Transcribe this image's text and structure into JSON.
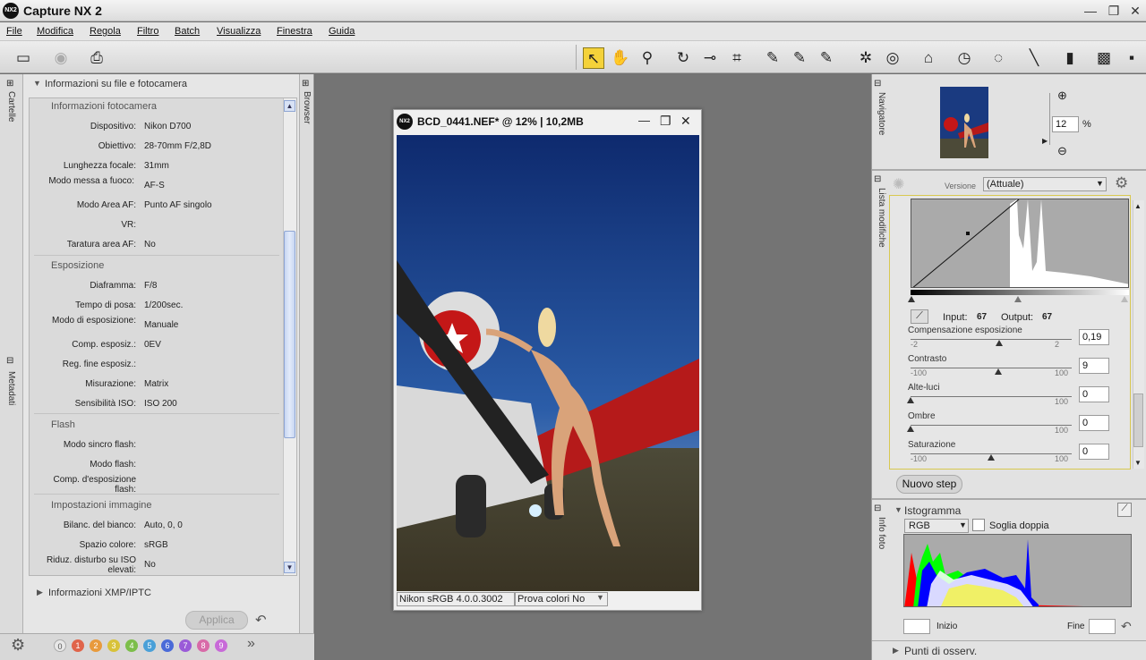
{
  "app": {
    "title": "Capture NX 2",
    "logo_text": "NX2"
  },
  "window_buttons": {
    "minimize": "—",
    "restore": "❐",
    "close": "✕"
  },
  "menu": [
    "File",
    "Modifica",
    "Regola",
    "Filtro",
    "Batch",
    "Visualizza",
    "Finestra",
    "Guida"
  ],
  "left_tabs": {
    "folders": "Cartelle",
    "metadata": "Metadati",
    "browser": "Browser"
  },
  "left_panel": {
    "header": "Informazioni su file e fotocamera",
    "sections": [
      {
        "title": "Informazioni fotocamera",
        "rows": [
          {
            "label": "Dispositivo:",
            "value": "Nikon D700"
          },
          {
            "label": "Obiettivo:",
            "value": "28-70mm F/2,8D"
          },
          {
            "label": "Lunghezza focale:",
            "value": "31mm"
          },
          {
            "label": "Modo messa a fuoco:",
            "value": "AF-S"
          },
          {
            "label": "Modo Area AF:",
            "value": "Punto AF singolo"
          },
          {
            "label": "VR:",
            "value": ""
          },
          {
            "label": "Taratura area AF:",
            "value": "No"
          }
        ]
      },
      {
        "title": "Esposizione",
        "rows": [
          {
            "label": "Diaframma:",
            "value": "F/8"
          },
          {
            "label": "Tempo di posa:",
            "value": "1/200sec."
          },
          {
            "label": "Modo di esposizione:",
            "value": "Manuale"
          },
          {
            "label": "Comp. esposiz.:",
            "value": "0EV"
          },
          {
            "label": "Reg. fine esposiz.:",
            "value": ""
          },
          {
            "label": "Misurazione:",
            "value": "Matrix"
          },
          {
            "label": "Sensibilità ISO:",
            "value": "ISO 200"
          }
        ]
      },
      {
        "title": "Flash",
        "rows": [
          {
            "label": "Modo sincro flash:",
            "value": ""
          },
          {
            "label": "Modo flash:",
            "value": ""
          },
          {
            "label": "Comp. d'esposizione flash:",
            "value": ""
          }
        ]
      },
      {
        "title": "Impostazioni immagine",
        "rows": [
          {
            "label": "Bilanc. del bianco:",
            "value": "Auto, 0, 0"
          },
          {
            "label": "Spazio colore:",
            "value": "sRGB"
          },
          {
            "label": "Riduz. disturbo su ISO elevati:",
            "value": "No"
          }
        ]
      }
    ],
    "xmp_header": "Informazioni XMP/IPTC",
    "apply_button": "Applica"
  },
  "labels_bar": [
    "0",
    "1",
    "2",
    "3",
    "4",
    "5",
    "6",
    "7",
    "8",
    "9"
  ],
  "label_colors": [
    "#e8e8e8",
    "#e0644a",
    "#e89a3c",
    "#d8c23a",
    "#7cbe4a",
    "#4aa0d8",
    "#4a6ad8",
    "#9a5ad8",
    "#d86aa8",
    "#c86ad8"
  ],
  "image_window": {
    "title": "BCD_0441.NEF* @ 12% | 10,2MB",
    "profile": "Nikon sRGB 4.0.0.3002",
    "proof": "Prova colori No"
  },
  "navigator": {
    "tab": "Navigatore",
    "zoom": "12",
    "zoom_unit": "%"
  },
  "edit_list": {
    "tab": "Lista modifiche",
    "version_label": "Versione",
    "version_value": "(Attuale)",
    "input_label": "Input:",
    "input_value": "67",
    "output_label": "Output:",
    "output_value": "67",
    "sliders": [
      {
        "name": "Compensazione esposizione",
        "min": "-2",
        "max": "2",
        "value": "0,19",
        "fraction": 0.55
      },
      {
        "name": "Contrasto",
        "min": "-100",
        "max": "100",
        "value": "9",
        "fraction": 0.545
      },
      {
        "name": "Alte-luci",
        "min": "",
        "max": "100",
        "value": "0",
        "fraction": 0
      },
      {
        "name": "Ombre",
        "min": "",
        "max": "100",
        "value": "0",
        "fraction": 0
      },
      {
        "name": "Saturazione",
        "min": "-100",
        "max": "100",
        "value": "0",
        "fraction": 0.5
      }
    ],
    "new_step": "Nuovo step"
  },
  "photo_info": {
    "tab": "Info foto",
    "histogram_title": "Istogramma",
    "channel": "RGB",
    "double_threshold": "Soglia doppia",
    "start_label": "Inizio",
    "end_label": "Fine",
    "points_title": "Punti di osserv."
  }
}
